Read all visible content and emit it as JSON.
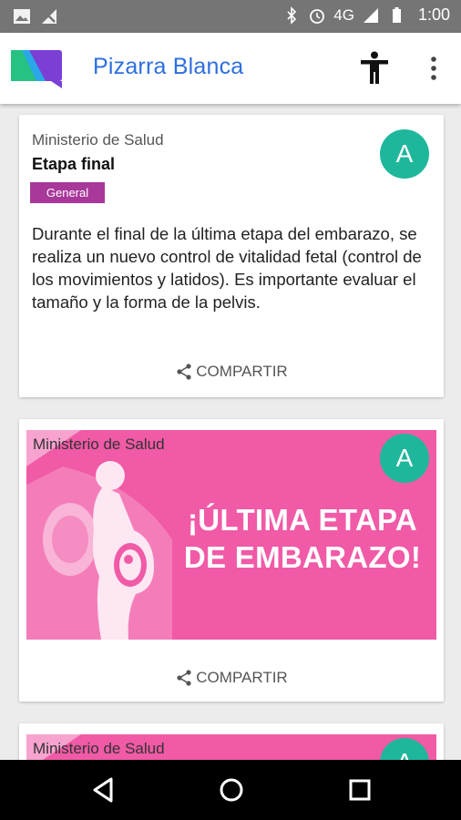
{
  "status_bar": {
    "network": "4G",
    "time": "1:00",
    "icons": [
      "image-icon",
      "no-signal-icon",
      "bluetooth-icon",
      "alarm-icon",
      "signal-icon",
      "battery-icon"
    ]
  },
  "app_bar": {
    "title": "Pizarra Blanca",
    "icons": [
      "app-logo",
      "accessibility-icon",
      "more-vert-icon"
    ],
    "colors": {
      "title": "#2d6fe0"
    }
  },
  "feed": {
    "posts": [
      {
        "source": "Ministerio de Salud",
        "title": "Etapa final",
        "tag": "General",
        "avatar": "A",
        "body": "Durante el final de la última etapa del embarazo, se realiza un nuevo control de vitalidad fetal (control de los movimientos y latidos). Es importante evaluar el tamaño y la forma de la pelvis.",
        "share_label": "COMPARTIR"
      },
      {
        "source": "Ministerio de Salud",
        "avatar": "A",
        "banner_headline": "¡ÚLTIMA ETAPA DE EMBARAZO!",
        "share_label": "COMPARTIR"
      },
      {
        "source": "Ministerio de Salud",
        "avatar": "A"
      }
    ],
    "colors": {
      "tag": "#a8389a",
      "avatar": "#1fb79c",
      "banner": "#f05aa6"
    }
  },
  "nav_bar": {
    "icons": [
      "back-icon",
      "home-icon",
      "recents-icon"
    ]
  }
}
